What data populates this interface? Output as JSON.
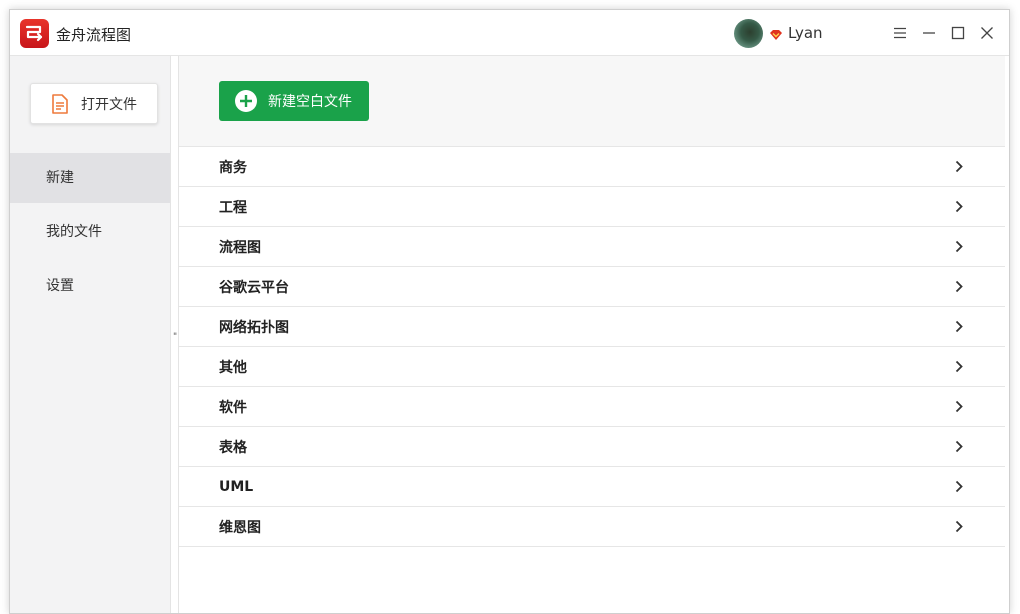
{
  "app": {
    "title": "金舟流程图"
  },
  "user": {
    "name": "Lyan"
  },
  "window_controls": [
    "menu-icon",
    "minimize-icon",
    "maximize-icon",
    "close-icon"
  ],
  "sidebar": {
    "open_file_label": "打开文件",
    "items": [
      {
        "label": "新建",
        "active": true
      },
      {
        "label": "我的文件",
        "active": false
      },
      {
        "label": "设置",
        "active": false
      }
    ]
  },
  "main": {
    "new_blank_label": "新建空白文件",
    "categories": [
      {
        "label": "商务"
      },
      {
        "label": "工程"
      },
      {
        "label": "流程图"
      },
      {
        "label": "谷歌云平台"
      },
      {
        "label": "网络拓扑图"
      },
      {
        "label": "其他"
      },
      {
        "label": "软件"
      },
      {
        "label": "表格"
      },
      {
        "label": "UML"
      },
      {
        "label": "维恩图"
      }
    ]
  },
  "colors": {
    "brand_red": "#d8231f",
    "primary_green": "#1aa24a",
    "sidebar_bg": "#f3f3f4",
    "active_nav_bg": "#e1e1e4",
    "vip_red": "#e0321f"
  }
}
